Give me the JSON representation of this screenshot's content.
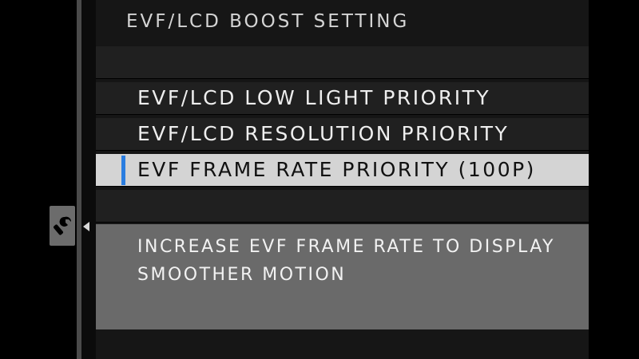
{
  "header": {
    "title": "EVF/LCD BOOST SETTING"
  },
  "menu": {
    "items": [
      {
        "label": "EVF/LCD LOW LIGHT PRIORITY",
        "selected": false
      },
      {
        "label": "EVF/LCD RESOLUTION PRIORITY",
        "selected": false
      },
      {
        "label": "EVF FRAME RATE PRIORITY (100P)",
        "selected": true
      }
    ]
  },
  "description": {
    "text": "INCREASE EVF FRAME RATE TO DISPLAY SMOOTHER MOTION"
  },
  "sidebar": {
    "active_tab_icon": "wrench-icon"
  },
  "colors": {
    "selection_accent": "#2a7de0",
    "selected_row_bg": "#d4d4d4",
    "description_bg": "#6a6a6a",
    "background": "#000000"
  }
}
